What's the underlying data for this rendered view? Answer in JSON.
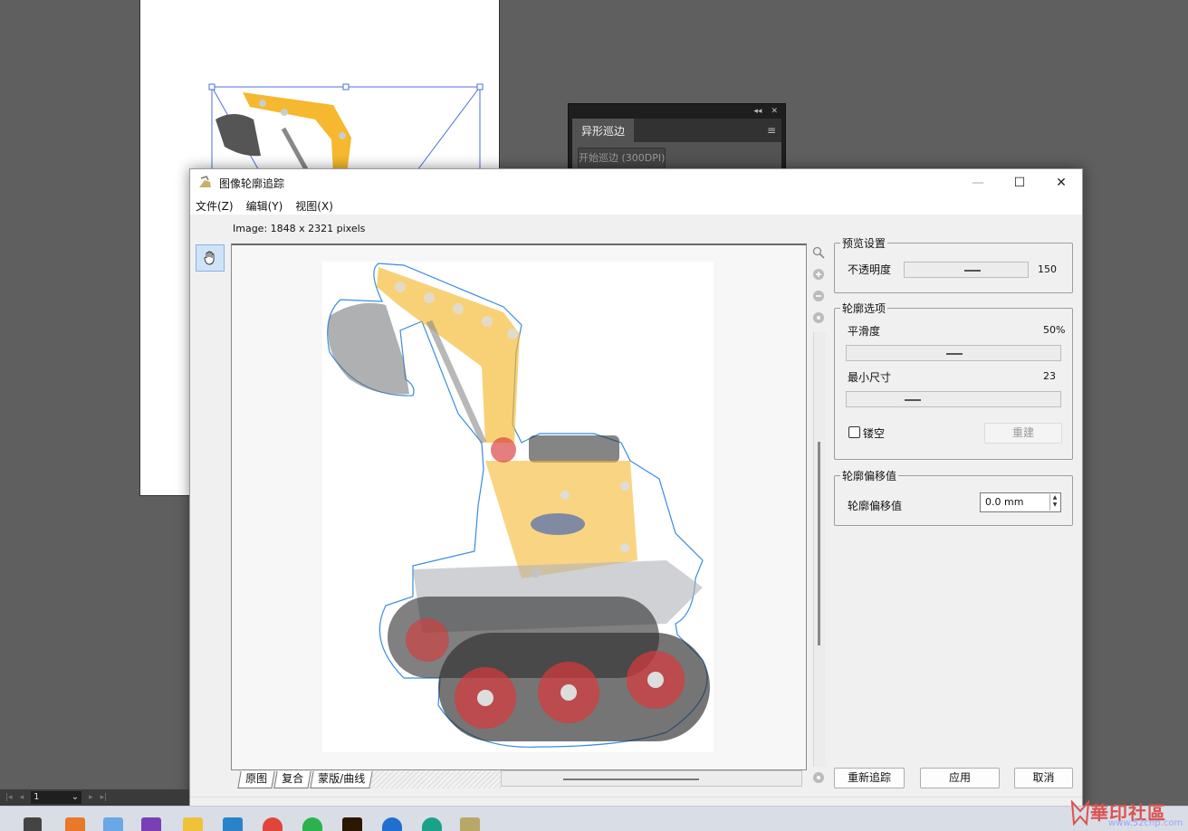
{
  "app": {
    "dialog_title": "图像轮廓追踪",
    "icons": {
      "app": "excavator-app-icon",
      "minimize": "minimize-icon",
      "maximize": "maximize-icon",
      "close": "close-icon"
    }
  },
  "background_panel": {
    "tab_label": "异形巡边",
    "button_label": "开始巡边 (300DPI)"
  },
  "menu": {
    "items": [
      "文件(Z)",
      "编辑(Y)",
      "视图(X)"
    ]
  },
  "image_info": "Image: 1848 x 2321 pixels",
  "canvas": {
    "view_tabs": [
      "原图",
      "复合",
      "蒙版/曲线"
    ],
    "zoom_icons": [
      "zoom-icon",
      "zoom-in-icon",
      "zoom-out-icon",
      "fit-icon"
    ]
  },
  "preview": {
    "group_label": "预览设置",
    "opacity_label": "不透明度",
    "opacity_value": "150"
  },
  "contour": {
    "group_label": "轮廓选项",
    "smooth_label": "平滑度",
    "smooth_value": "50%",
    "min_size_label": "最小尺寸",
    "min_size_value": "23",
    "hollow_label": "镂空",
    "hollow_checked": false,
    "rebuild_label": "重建"
  },
  "offset": {
    "group_label": "轮廓偏移值",
    "label": "轮廓偏移值",
    "value": "0.0 mm"
  },
  "footer": {
    "retrace_label": "重新追踪",
    "apply_label": "应用",
    "cancel_label": "取消"
  },
  "ps_status": {
    "page_value": "1"
  },
  "watermark": {
    "text": "華印社區",
    "url": "www.52cnp.com"
  },
  "colors": {
    "accent_blue": "#3a7bd5",
    "contour_blue": "#2f86e0",
    "excavator_yellow": "#f5b82e",
    "track_red": "#d9393b"
  }
}
